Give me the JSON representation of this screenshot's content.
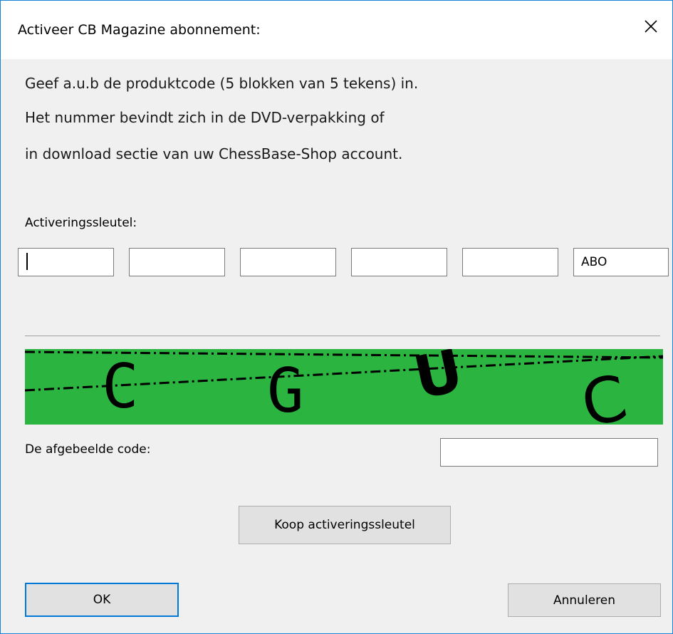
{
  "window": {
    "title": "Activeer CB Magazine abonnement:",
    "close_glyph": "✕"
  },
  "info": {
    "line1": "Geef a.u.b de produktcode (5 blokken van 5 tekens) in.",
    "line2": "Het nummer bevindt zich in de DVD-verpakking of",
    "line3": "in download sectie van uw ChessBase-Shop account."
  },
  "activation": {
    "label": "Activeringssleutel:",
    "blocks": [
      "",
      "",
      "",
      "",
      "",
      "ABO"
    ]
  },
  "captcha": {
    "letters": [
      "C",
      "G",
      "U",
      "C"
    ],
    "background_color": "#2bb540",
    "ink_color": "#000000"
  },
  "code": {
    "label": "De afgebeelde code:",
    "value": ""
  },
  "buttons": {
    "buy": "Koop activeringssleutel",
    "ok": "OK",
    "cancel": "Annuleren"
  },
  "colors": {
    "accent": "#0078d7",
    "window_border": "#1883d7",
    "dialog_bg": "#f0f0f0"
  }
}
